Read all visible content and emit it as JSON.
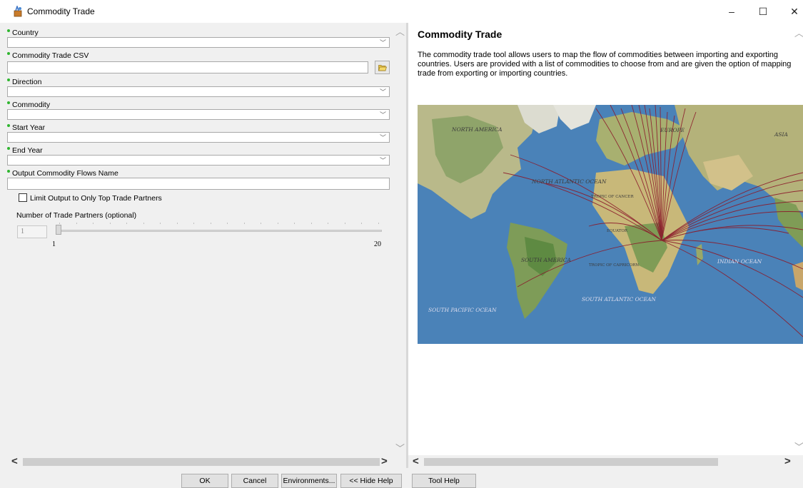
{
  "window": {
    "title": "Commodity Trade",
    "minimize": "–",
    "maximize": "☐",
    "close": "✕"
  },
  "params": {
    "country": {
      "label": "Country",
      "value": ""
    },
    "commodity_csv": {
      "label": "Commodity Trade CSV",
      "value": ""
    },
    "direction": {
      "label": "Direction",
      "value": ""
    },
    "commodity": {
      "label": "Commodity",
      "value": ""
    },
    "start_year": {
      "label": "Start Year",
      "value": ""
    },
    "end_year": {
      "label": "End Year",
      "value": ""
    },
    "output_name": {
      "label": "Output Commodity Flows Name",
      "value": ""
    },
    "limit_output": {
      "label": "Limit Output to Only Top Trade Partners",
      "checked": false
    },
    "num_partners": {
      "label": "Number of Trade Partners (optional)",
      "value": "1",
      "min": "1",
      "max": "20"
    }
  },
  "help": {
    "title": "Commodity Trade",
    "description": "The commodity trade tool allows users to map the flow of commodities between importing and exporting countries. Users are provided with a list of commodities to choose from and are given the option of mapping trade from exporting or importing countries.",
    "map_labels": {
      "north_america": "NORTH AMERICA",
      "europe": "EUROPE",
      "asia": "ASIA",
      "north_atlantic": "NORTH ATLANTIC OCEAN",
      "cancer": "TROPIC OF CANCER",
      "equator": "EQUATOR",
      "south_america": "SOUTH AMERICA",
      "capricorn": "TROPIC OF CAPRICORN",
      "indian": "INDIAN OCEAN",
      "south_atlantic": "SOUTH ATLANTIC OCEAN",
      "south_pacific": "SOUTH PACIFIC OCEAN"
    }
  },
  "buttons": {
    "ok": "OK",
    "cancel": "Cancel",
    "environments": "Environments...",
    "hide_help": "<< Hide Help",
    "tool_help": "Tool Help"
  },
  "colors": {
    "flow_lines": "#8b1a2b",
    "required_dot": "#2fb52f"
  }
}
